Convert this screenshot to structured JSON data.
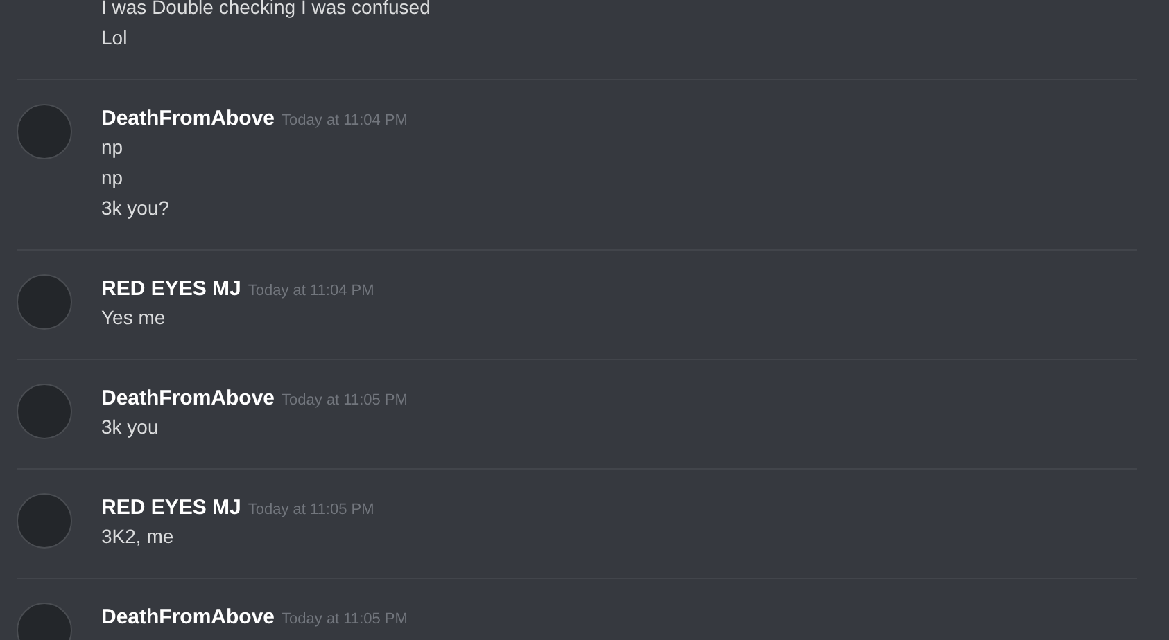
{
  "messages": [
    {
      "lines": [
        "I was Double checking I was confused",
        "Lol"
      ]
    },
    {
      "author": "DeathFromAbove",
      "time": "Today at 11:04 PM",
      "lines": [
        "np",
        "np",
        "3k you?"
      ]
    },
    {
      "author": "RED EYES MJ",
      "time": "Today at 11:04 PM",
      "lines": [
        "Yes me"
      ]
    },
    {
      "author": "DeathFromAbove",
      "time": "Today at 11:05 PM",
      "lines": [
        "3k you"
      ]
    },
    {
      "author": "RED EYES MJ",
      "time": "Today at 11:05 PM",
      "lines": [
        "3K2, me"
      ]
    },
    {
      "author": "DeathFromAbove",
      "time": "Today at 11:05 PM"
    }
  ]
}
